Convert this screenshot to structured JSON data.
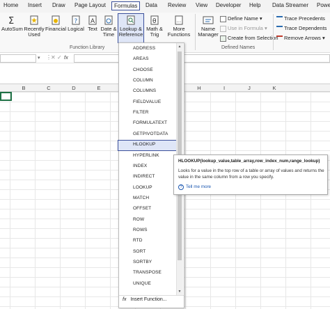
{
  "tabs": [
    "Home",
    "Insert",
    "Draw",
    "Page Layout",
    "Formulas",
    "Data",
    "Review",
    "View",
    "Developer",
    "Help",
    "Data Streamer",
    "Powe"
  ],
  "ribbon": {
    "autosum": "AutoSum",
    "recently_used": [
      "Recently",
      "Used"
    ],
    "financial": "Financial",
    "logical": "Logical",
    "text": "Text",
    "date_time": [
      "Date &",
      "Time"
    ],
    "lookup_reference": [
      "Lookup &",
      "Reference"
    ],
    "math_trig": [
      "Math &",
      "Trig"
    ],
    "more_functions": [
      "More",
      "Functions"
    ],
    "name_manager": [
      "Name",
      "Manager"
    ],
    "define_name": "Define Name",
    "use_in_formula": "Use in Formula",
    "create_from_selection": "Create from Selection",
    "trace_precedents": "Trace Precedents",
    "trace_dependents": "Trace Dependents",
    "remove_arrows": "Remove Arrows",
    "group_function_library": "Function Library",
    "group_defined_names": "Defined Names"
  },
  "formula_bar": {
    "fx": "fx"
  },
  "columns": [
    "B",
    "C",
    "D",
    "E",
    "",
    "",
    "H",
    "I",
    "J",
    "K"
  ],
  "dropdown": {
    "items": [
      "ADDRESS",
      "AREAS",
      "CHOOSE",
      "COLUMN",
      "COLUMNS",
      "FIELDVALUE",
      "FILTER",
      "FORMULATEXT",
      "GETPIVOTDATA",
      "HLOOKUP",
      "HYPERLINK",
      "INDEX",
      "INDIRECT",
      "LOOKUP",
      "MATCH",
      "OFFSET",
      "ROW",
      "ROWS",
      "RTD",
      "SORT",
      "SORTBY",
      "TRANSPOSE",
      "UNIQUE"
    ],
    "highlighted": "HLOOKUP",
    "insert_function": "Insert Function..."
  },
  "tooltip": {
    "title": "HLOOKUP(lookup_value,table_array,row_index_num,range_lookup)",
    "description": "Looks for a value in the top row of a table or array of values and returns the value in the same column from a row you specify.",
    "tell_me_more": "Tell me more"
  },
  "colors": {
    "accent": "#3b4f9b",
    "selected_cell": "#1e7145",
    "link": "#1a56b0"
  }
}
